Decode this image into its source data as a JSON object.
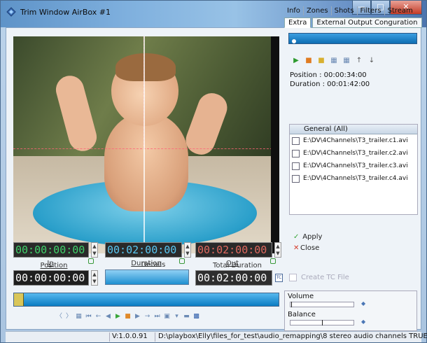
{
  "window": {
    "title": "Trim Window AirBox #1"
  },
  "tabs_row1": [
    "Info",
    "Zones",
    "Shots",
    "Filters",
    "Stream"
  ],
  "tabs_row2": [
    "Extra",
    "External Output Conguration"
  ],
  "time": {
    "in_label": "In",
    "in_value": "00:00:00:00",
    "duration_label": "Duration",
    "duration_value": "00:02:00:00",
    "out_label": "Out",
    "out_value": "00:02:00:00",
    "position_label": "Position",
    "position_value": "00:00:00:00",
    "details_label": "Details",
    "total_label": "Total Duration",
    "total_value": "00:02:00:00",
    "tc_label": "TC"
  },
  "info": {
    "position": "Position : 00:00:34:00",
    "duration": "Duration : 00:01:42:00"
  },
  "list": {
    "header": "General (All)",
    "items": [
      "E:\\DV\\4Channels\\T3_trailer.c1.avi",
      "E:\\DV\\4Channels\\T3_trailer.c2.avi",
      "E:\\DV\\4Channels\\T3_trailer.c3.avi",
      "E:\\DV\\4Channels\\T3_trailer.c4.avi"
    ]
  },
  "actions": {
    "apply": "Apply",
    "close": "Close",
    "create_tc": "Create TC File"
  },
  "audio": {
    "volume": "Volume",
    "balance": "Balance"
  },
  "status": {
    "version": "V:1.0.0.91",
    "path": "D:\\playbox\\Elly\\files_for_test\\audio_remapping\\8 stereo audio channels TRUE"
  },
  "colors": {
    "accent_blue": "#1e8fd0",
    "timecode_green": "#3fd16a",
    "timecode_blue": "#59c7f2",
    "timecode_red": "#e0695f",
    "timecode_white": "#ffffff"
  },
  "progress": {
    "position_fraction": 0.02
  }
}
